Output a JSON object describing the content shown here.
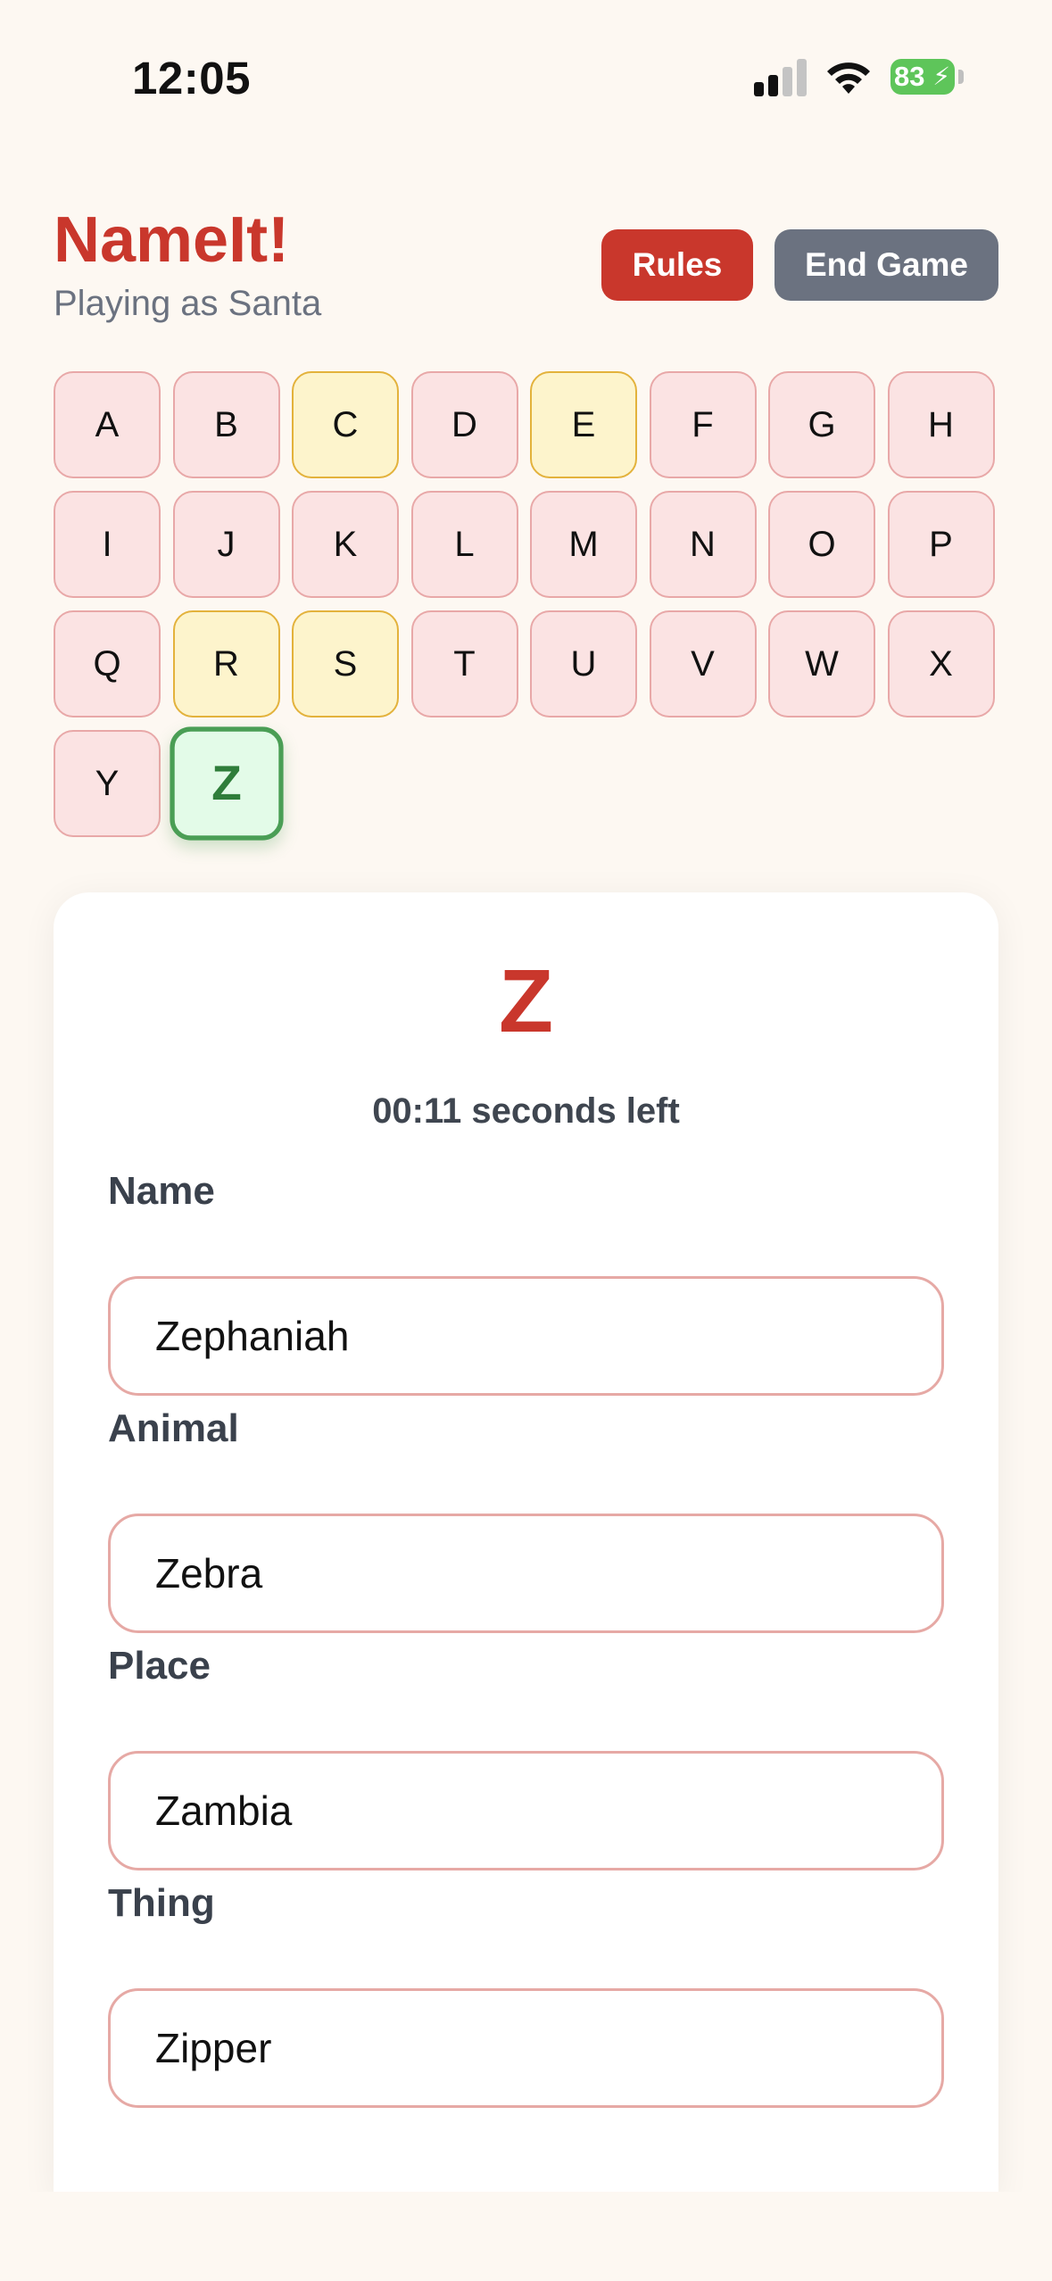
{
  "status_bar": {
    "time": "12:05",
    "battery_percent": "83",
    "icons": [
      "cellular-signal-icon",
      "wifi-icon",
      "battery-charging-icon"
    ]
  },
  "header": {
    "title": "NameIt!",
    "subtitle": "Playing as Santa",
    "rules_label": "Rules",
    "end_game_label": "End Game"
  },
  "colors": {
    "accent": "#c9372c",
    "secondary_button": "#6b7280",
    "tile_unused": "#fbe3e3",
    "tile_used": "#fdf4cc",
    "tile_current": "#e3fbe8"
  },
  "letters": [
    {
      "letter": "A",
      "state": "unused"
    },
    {
      "letter": "B",
      "state": "unused"
    },
    {
      "letter": "C",
      "state": "used"
    },
    {
      "letter": "D",
      "state": "unused"
    },
    {
      "letter": "E",
      "state": "used"
    },
    {
      "letter": "F",
      "state": "unused"
    },
    {
      "letter": "G",
      "state": "unused"
    },
    {
      "letter": "H",
      "state": "unused"
    },
    {
      "letter": "I",
      "state": "unused"
    },
    {
      "letter": "J",
      "state": "unused"
    },
    {
      "letter": "K",
      "state": "unused"
    },
    {
      "letter": "L",
      "state": "unused"
    },
    {
      "letter": "M",
      "state": "unused"
    },
    {
      "letter": "N",
      "state": "unused"
    },
    {
      "letter": "O",
      "state": "unused"
    },
    {
      "letter": "P",
      "state": "unused"
    },
    {
      "letter": "Q",
      "state": "unused"
    },
    {
      "letter": "R",
      "state": "used"
    },
    {
      "letter": "S",
      "state": "used"
    },
    {
      "letter": "T",
      "state": "unused"
    },
    {
      "letter": "U",
      "state": "unused"
    },
    {
      "letter": "V",
      "state": "unused"
    },
    {
      "letter": "W",
      "state": "unused"
    },
    {
      "letter": "X",
      "state": "unused"
    },
    {
      "letter": "Y",
      "state": "unused"
    },
    {
      "letter": "Z",
      "state": "current"
    }
  ],
  "round": {
    "current_letter": "Z",
    "timer_text": "00:11 seconds left",
    "fields": [
      {
        "label": "Name",
        "value": "Zephaniah"
      },
      {
        "label": "Animal",
        "value": "Zebra"
      },
      {
        "label": "Place",
        "value": "Zambia"
      },
      {
        "label": "Thing",
        "value": "Zipper"
      }
    ]
  }
}
